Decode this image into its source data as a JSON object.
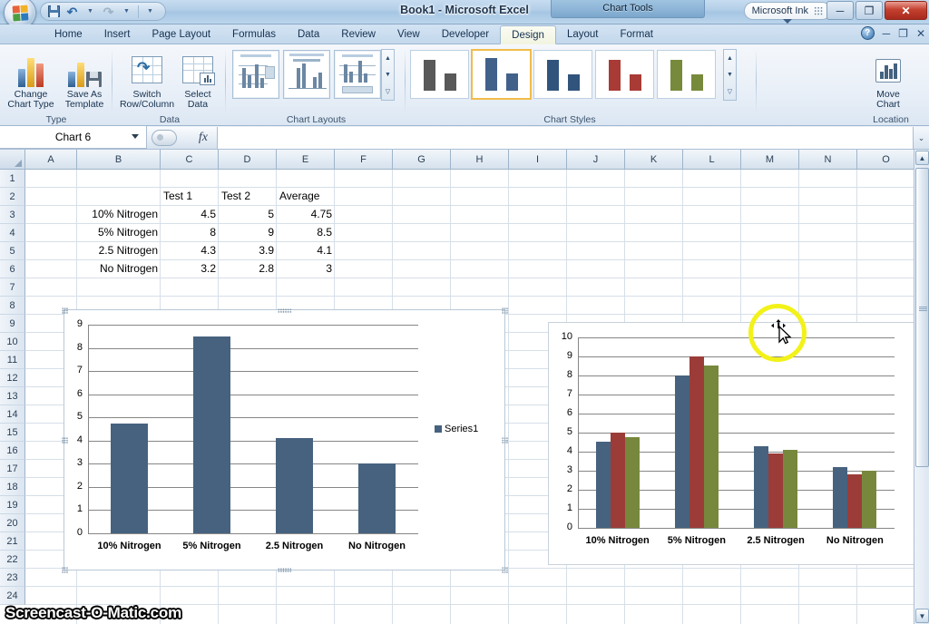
{
  "titlebar": {
    "document_title": "Book1 - Microsoft Excel",
    "contextual_tab_group": "Chart Tools",
    "ink_toolbar_label": "Microsoft Ink",
    "quick_access": [
      {
        "name": "office-button",
        "label": "Office"
      },
      {
        "name": "save",
        "label": "Save"
      },
      {
        "name": "undo",
        "label": "Undo"
      },
      {
        "name": "redo",
        "label": "Redo"
      },
      {
        "name": "customize-qat",
        "label": "Customize Quick Access Toolbar"
      }
    ],
    "window_buttons": {
      "minimize": "─",
      "restore": "❐",
      "close": "✕"
    }
  },
  "ribbon": {
    "tabs": [
      {
        "label": "Home",
        "active": false
      },
      {
        "label": "Insert",
        "active": false
      },
      {
        "label": "Page Layout",
        "active": false
      },
      {
        "label": "Formulas",
        "active": false
      },
      {
        "label": "Data",
        "active": false
      },
      {
        "label": "Review",
        "active": false
      },
      {
        "label": "View",
        "active": false
      },
      {
        "label": "Developer",
        "active": false
      },
      {
        "label": "Design",
        "active": true
      },
      {
        "label": "Layout",
        "active": false
      },
      {
        "label": "Format",
        "active": false
      }
    ],
    "right_controls": {
      "help": "?",
      "minimize_ribbon": "─",
      "restore_window": "❐",
      "close_window": "✕"
    },
    "groups": [
      {
        "name": "type",
        "label": "Type",
        "buttons": [
          {
            "label_line1": "Change",
            "label_line2": "Chart Type",
            "icon": "change-chart-type-icon"
          },
          {
            "label_line1": "Save As",
            "label_line2": "Template",
            "icon": "save-as-template-icon"
          }
        ]
      },
      {
        "name": "data",
        "label": "Data",
        "buttons": [
          {
            "label_line1": "Switch",
            "label_line2": "Row/Column",
            "icon": "switch-row-column-icon"
          },
          {
            "label_line1": "Select",
            "label_line2": "Data",
            "icon": "select-data-icon"
          }
        ]
      },
      {
        "name": "chart-layouts",
        "label": "Chart Layouts",
        "items": [
          "layout-1",
          "layout-2",
          "layout-3"
        ]
      },
      {
        "name": "chart-styles",
        "label": "Chart Styles",
        "items": [
          {
            "name": "style-1",
            "color": "#595959",
            "selected": false
          },
          {
            "name": "style-2",
            "color": "#41618a",
            "selected": true
          },
          {
            "name": "style-3",
            "color": "#31547c",
            "selected": false
          },
          {
            "name": "style-4",
            "color": "#a83b35",
            "selected": false
          },
          {
            "name": "style-5",
            "color": "#77893a",
            "selected": false
          }
        ]
      },
      {
        "name": "location",
        "label": "Location",
        "buttons": [
          {
            "label_line1": "Move",
            "label_line2": "Chart",
            "icon": "move-chart-icon"
          }
        ]
      }
    ]
  },
  "formula_bar": {
    "name_box_value": "Chart 6",
    "fx_label": "fx",
    "formula_value": "",
    "expand_icon": "⌄"
  },
  "grid": {
    "columns": [
      "A",
      "B",
      "C",
      "D",
      "E",
      "F",
      "G",
      "H",
      "I",
      "J",
      "K",
      "L",
      "M",
      "N",
      "O"
    ],
    "rows": [
      "1",
      "2",
      "3",
      "4",
      "5",
      "6",
      "7",
      "8",
      "9",
      "10",
      "11",
      "12",
      "13",
      "14",
      "15",
      "16",
      "17",
      "18",
      "19",
      "20",
      "21",
      "22",
      "23",
      "24"
    ],
    "data": [
      {
        "row": 2,
        "col": "C",
        "value": "Test 1",
        "align": "l"
      },
      {
        "row": 2,
        "col": "D",
        "value": "Test 2",
        "align": "l"
      },
      {
        "row": 2,
        "col": "E",
        "value": "Average",
        "align": "l"
      },
      {
        "row": 3,
        "col": "B",
        "value": "10% Nitrogen",
        "align": "r"
      },
      {
        "row": 3,
        "col": "C",
        "value": "4.5",
        "align": "r"
      },
      {
        "row": 3,
        "col": "D",
        "value": "5",
        "align": "r"
      },
      {
        "row": 3,
        "col": "E",
        "value": "4.75",
        "align": "r"
      },
      {
        "row": 4,
        "col": "B",
        "value": "5% Nitrogen",
        "align": "r"
      },
      {
        "row": 4,
        "col": "C",
        "value": "8",
        "align": "r"
      },
      {
        "row": 4,
        "col": "D",
        "value": "9",
        "align": "r"
      },
      {
        "row": 4,
        "col": "E",
        "value": "8.5",
        "align": "r"
      },
      {
        "row": 5,
        "col": "B",
        "value": "2.5 Nitrogen",
        "align": "r"
      },
      {
        "row": 5,
        "col": "C",
        "value": "4.3",
        "align": "r"
      },
      {
        "row": 5,
        "col": "D",
        "value": "3.9",
        "align": "r"
      },
      {
        "row": 5,
        "col": "E",
        "value": "4.1",
        "align": "r"
      },
      {
        "row": 6,
        "col": "B",
        "value": "No Nitrogen",
        "align": "r"
      },
      {
        "row": 6,
        "col": "C",
        "value": "3.2",
        "align": "r"
      },
      {
        "row": 6,
        "col": "D",
        "value": "2.8",
        "align": "r"
      },
      {
        "row": 6,
        "col": "E",
        "value": "3",
        "align": "r"
      }
    ]
  },
  "chart_data": [
    {
      "name": "chart-6-selected",
      "type": "bar",
      "title": "",
      "categories": [
        "10% Nitrogen",
        "5% Nitrogen",
        "2.5 Nitrogen",
        "No Nitrogen"
      ],
      "series": [
        {
          "name": "Series1",
          "values": [
            4.75,
            8.5,
            4.1,
            3
          ],
          "color": "#46627f"
        }
      ],
      "legend": [
        "Series1"
      ],
      "legend_position": "right",
      "ylim": [
        0,
        9
      ],
      "yticks": [
        0,
        1,
        2,
        3,
        4,
        5,
        6,
        7,
        8,
        9
      ],
      "xlabel": "",
      "ylabel": "",
      "grid": true,
      "selected": true
    },
    {
      "name": "chart-7",
      "type": "bar",
      "title": "",
      "categories": [
        "10% Nitrogen",
        "5% Nitrogen",
        "2.5 Nitrogen",
        "No Nitrogen"
      ],
      "series": [
        {
          "name": "Test 1",
          "values": [
            4.5,
            8,
            4.3,
            3.2
          ],
          "color": "#46627f"
        },
        {
          "name": "Test 2",
          "values": [
            5,
            9,
            3.9,
            2.8
          ],
          "color": "#9c3c38"
        },
        {
          "name": "Average",
          "values": [
            4.75,
            8.5,
            4.1,
            3
          ],
          "color": "#77883d"
        }
      ],
      "legend": [],
      "legend_position": "none",
      "ylim": [
        0,
        10
      ],
      "yticks": [
        0,
        1,
        2,
        3,
        4,
        5,
        6,
        7,
        8,
        9,
        10
      ],
      "xlabel": "",
      "ylabel": "",
      "grid": true,
      "selected": false
    }
  ],
  "overlay": {
    "watermark": "Screencast-O-Matic.com",
    "cursor_type": "move-cursor",
    "highlight_color": "#f2f21a"
  }
}
